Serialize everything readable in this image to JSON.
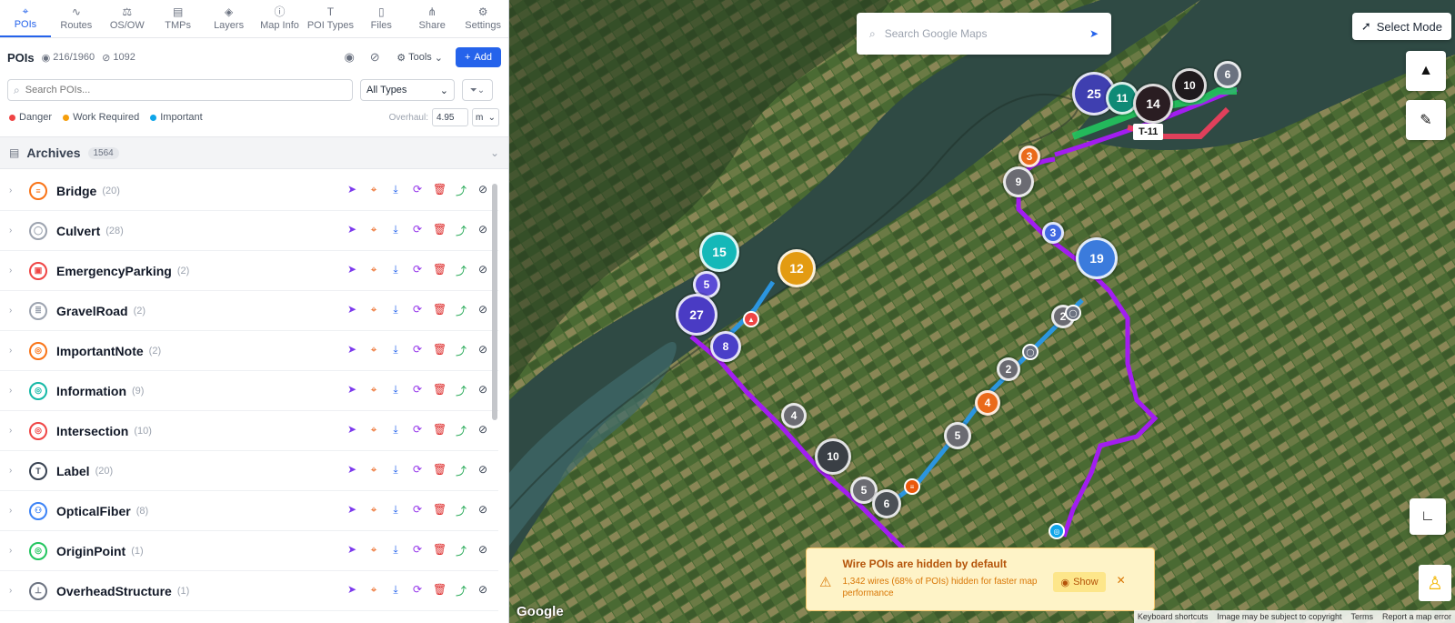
{
  "nav": {
    "items": [
      {
        "label": "POIs",
        "icon": "pin-icon",
        "glyph": "⌖",
        "active": true
      },
      {
        "label": "Routes",
        "icon": "routes-icon",
        "glyph": "∿"
      },
      {
        "label": "OS/OW",
        "icon": "scale-icon",
        "glyph": "⚖"
      },
      {
        "label": "TMPs",
        "icon": "clipboard-icon",
        "glyph": "▤"
      },
      {
        "label": "Layers",
        "icon": "layers-icon",
        "glyph": "◈"
      },
      {
        "label": "Map Info",
        "icon": "info-icon",
        "glyph": "ⓘ"
      },
      {
        "label": "POI Types",
        "icon": "type-icon",
        "glyph": "T"
      },
      {
        "label": "Files",
        "icon": "file-icon",
        "glyph": "▯"
      },
      {
        "label": "Share",
        "icon": "share-icon",
        "glyph": "⋔"
      },
      {
        "label": "Settings",
        "icon": "gear-icon",
        "glyph": "⚙"
      }
    ]
  },
  "toolbar": {
    "title": "POIs",
    "visible_count": "216/1960",
    "hidden_count": "1092",
    "tools_label": "Tools",
    "add_label": "Add"
  },
  "filters": {
    "search_placeholder": "Search POIs...",
    "type_select": "All Types"
  },
  "legend": {
    "items": [
      {
        "label": "Danger",
        "color": "#ef4444"
      },
      {
        "label": "Work Required",
        "color": "#f59e0b"
      },
      {
        "label": "Important",
        "color": "#0ea5e9"
      }
    ],
    "overhaul_label": "Overhaul:",
    "overhaul_value": "4.95",
    "unit": "m"
  },
  "archives": {
    "title": "Archives",
    "count": "1564"
  },
  "rows": [
    {
      "name": "Bridge",
      "count": "(20)",
      "color": "#f97316",
      "glyph": "≡"
    },
    {
      "name": "Culvert",
      "count": "(28)",
      "color": "#9ca3af",
      "glyph": "◯"
    },
    {
      "name": "EmergencyParking",
      "count": "(2)",
      "color": "#ef4444",
      "glyph": "▣"
    },
    {
      "name": "GravelRoad",
      "count": "(2)",
      "color": "#9ca3af",
      "glyph": "≣"
    },
    {
      "name": "ImportantNote",
      "count": "(2)",
      "color": "#f97316",
      "glyph": "◎"
    },
    {
      "name": "Information",
      "count": "(9)",
      "color": "#14b8a6",
      "glyph": "◎"
    },
    {
      "name": "Intersection",
      "count": "(10)",
      "color": "#ef4444",
      "glyph": "◎"
    },
    {
      "name": "Label",
      "count": "(20)",
      "color": "#374151",
      "glyph": "T"
    },
    {
      "name": "OpticalFiber",
      "count": "(8)",
      "color": "#3b82f6",
      "glyph": "⚇"
    },
    {
      "name": "OriginPoint",
      "count": "(1)",
      "color": "#22c55e",
      "glyph": "◎"
    },
    {
      "name": "OverheadStructure",
      "count": "(1)",
      "color": "#6b7280",
      "glyph": "⊥"
    }
  ],
  "map": {
    "search_placeholder": "Search Google Maps",
    "select_mode_label": "Select Mode",
    "segment_label": "T-11",
    "google_label": "Google",
    "attribution": [
      "Keyboard shortcuts",
      "Image may be subject to copyright",
      "Terms",
      "Report a map error"
    ],
    "clusters": [
      {
        "label": "25",
        "color": "#3f3fb0"
      },
      {
        "label": "11",
        "color": "#0f8a76"
      },
      {
        "label": "14",
        "color": "#2a1d22"
      },
      {
        "label": "10",
        "color": "#1f1a1d"
      },
      {
        "label": "6",
        "color": "#6b7280"
      },
      {
        "label": "3",
        "color": "#ea6a1a"
      },
      {
        "label": "9",
        "color": "#6b6b72"
      },
      {
        "label": "3",
        "color": "#4169e1"
      },
      {
        "label": "19",
        "color": "#3b7bdc"
      },
      {
        "label": "15",
        "color": "#14b8b8"
      },
      {
        "label": "12",
        "color": "#e39b12"
      },
      {
        "label": "5",
        "color": "#5b4bd6"
      },
      {
        "label": "27",
        "color": "#4a3bc4"
      },
      {
        "label": "8",
        "color": "#4a3fc8"
      },
      {
        "label": "2",
        "color": "#6b6b72"
      },
      {
        "label": "2",
        "color": "#6b6b72"
      },
      {
        "label": "4",
        "color": "#ea6a1a"
      },
      {
        "label": "4",
        "color": "#6b6b72"
      },
      {
        "label": "5",
        "color": "#6b6b72"
      },
      {
        "label": "10",
        "color": "#3a3f45"
      },
      {
        "label": "5",
        "color": "#6b6b72"
      },
      {
        "label": "6",
        "color": "#4b5056"
      }
    ]
  },
  "toast": {
    "title": "Wire POIs are hidden by default",
    "description": "1,342 wires (68% of POIs) hidden for faster map performance",
    "show_label": "Show"
  }
}
